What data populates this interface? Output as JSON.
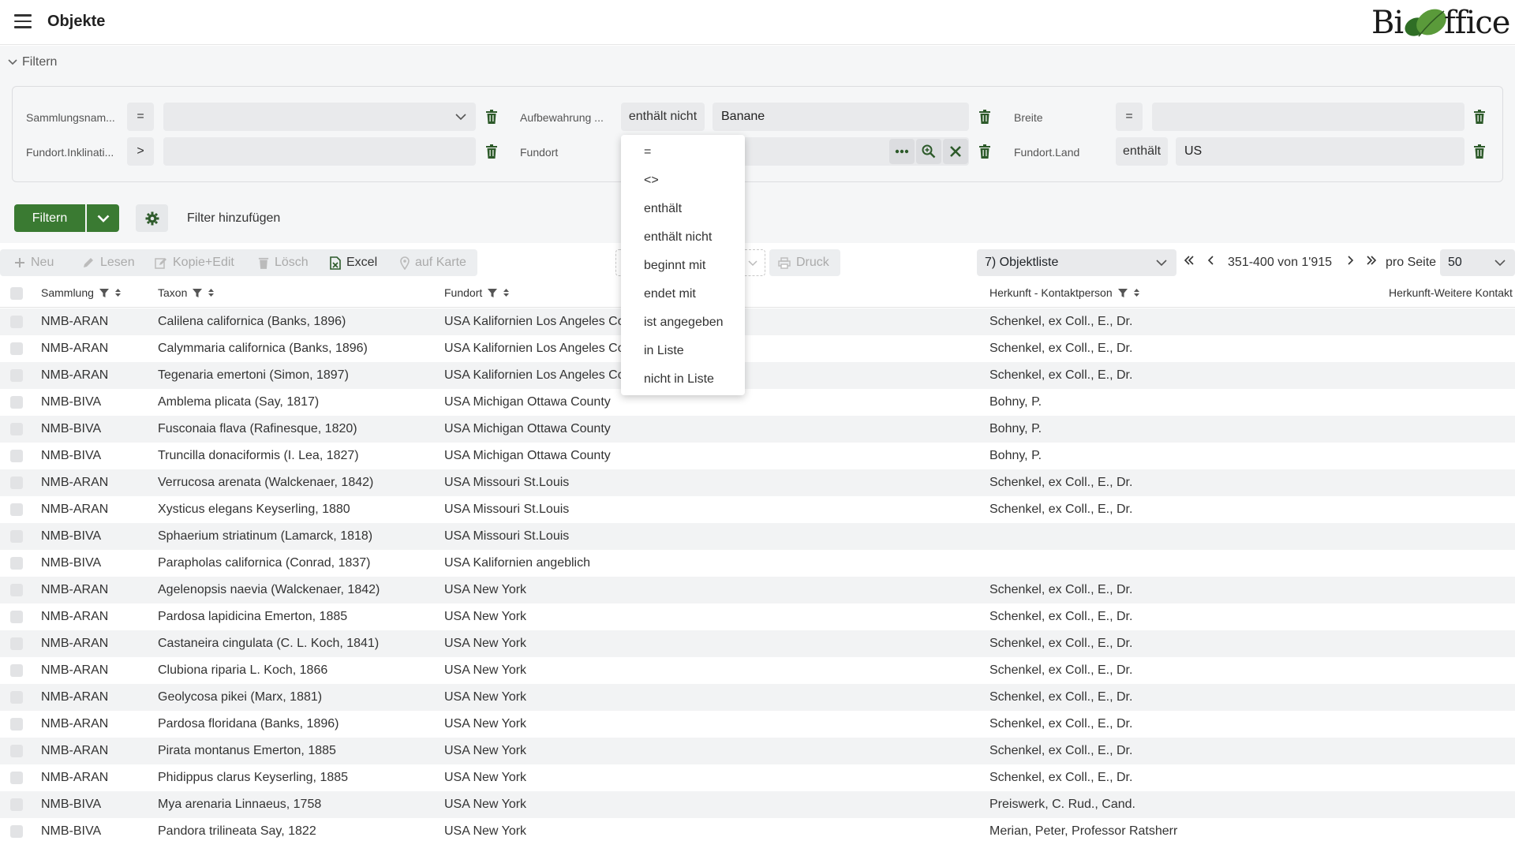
{
  "header": {
    "title": "Objekte",
    "logo_text_left": "Bi",
    "logo_text_right": "ffice"
  },
  "filter_panel": {
    "toggle_label": "Filtern",
    "rows": [
      [
        {
          "label": "Sammlungsnam...",
          "op": "=",
          "value": ""
        },
        {
          "label": "Aufbewahrung ...",
          "op": "enthält nicht",
          "value": "Banane"
        },
        {
          "label": "Breite",
          "op": "=",
          "value": ""
        }
      ],
      [
        {
          "label": "Fundort.Inklinati...",
          "op": ">",
          "value": ""
        },
        {
          "label": "Fundort",
          "op": "",
          "value": ""
        },
        {
          "label": "Fundort.Land",
          "op": "enthält",
          "value": "US"
        }
      ]
    ],
    "filter_button": "Filtern",
    "add_filter": "Filter hinzufügen"
  },
  "operator_dropdown": {
    "options": [
      "=",
      "<>",
      "enthält",
      "enthält nicht",
      "beginnt mit",
      "endet mit",
      "ist angegeben",
      "in Liste",
      "nicht in Liste"
    ]
  },
  "toolbar": {
    "new": "Neu",
    "read": "Lesen",
    "copy_edit": "Kopie+Edit",
    "delete": "Lösch",
    "excel": "Excel",
    "map": "auf Karte",
    "print": "Druck",
    "list_select": "7) Objektliste",
    "page_info": "351-400 von 1'915",
    "per_page_label": "pro Seite",
    "per_page_value": "50"
  },
  "table": {
    "columns": [
      "Sammlung",
      "Taxon",
      "Fundort",
      "Herkunft - Kontaktperson",
      "Herkunft-Weitere Kontakt"
    ],
    "rows": [
      [
        "NMB-ARAN",
        "Calilena californica (Banks, 1896)",
        "USA Kalifornien Los Angeles Co",
        "Schenkel, ex Coll., E., Dr."
      ],
      [
        "NMB-ARAN",
        "Calymmaria californica (Banks, 1896)",
        "USA Kalifornien Los Angeles Co",
        "Schenkel, ex Coll., E., Dr."
      ],
      [
        "NMB-ARAN",
        "Tegenaria emertoni (Simon, 1897)",
        "USA Kalifornien Los Angeles Co",
        "Schenkel, ex Coll., E., Dr."
      ],
      [
        "NMB-BIVA",
        "Amblema plicata (Say, 1817)",
        "USA Michigan Ottawa County",
        "Bohny, P."
      ],
      [
        "NMB-BIVA",
        "Fusconaia flava (Rafinesque, 1820)",
        "USA Michigan Ottawa County",
        "Bohny, P."
      ],
      [
        "NMB-BIVA",
        "Truncilla donaciformis (I. Lea, 1827)",
        "USA Michigan Ottawa County",
        "Bohny, P."
      ],
      [
        "NMB-ARAN",
        "Verrucosa arenata (Walckenaer, 1842)",
        "USA Missouri St.Louis",
        "Schenkel, ex Coll., E., Dr."
      ],
      [
        "NMB-ARAN",
        "Xysticus elegans Keyserling, 1880",
        "USA Missouri St.Louis",
        "Schenkel, ex Coll., E., Dr."
      ],
      [
        "NMB-BIVA",
        "Sphaerium striatinum (Lamarck, 1818)",
        "USA Missouri St.Louis",
        ""
      ],
      [
        "NMB-BIVA",
        "Parapholas californica (Conrad, 1837)",
        "USA Kalifornien angeblich",
        ""
      ],
      [
        "NMB-ARAN",
        "Agelenopsis naevia (Walckenaer, 1842)",
        "USA New York",
        "Schenkel, ex Coll., E., Dr."
      ],
      [
        "NMB-ARAN",
        "Pardosa lapidicina Emerton, 1885",
        "USA New York",
        "Schenkel, ex Coll., E., Dr."
      ],
      [
        "NMB-ARAN",
        "Castaneira cingulata (C. L. Koch, 1841)",
        "USA New York",
        "Schenkel, ex Coll., E., Dr."
      ],
      [
        "NMB-ARAN",
        "Clubiona riparia L. Koch, 1866",
        "USA New York",
        "Schenkel, ex Coll., E., Dr."
      ],
      [
        "NMB-ARAN",
        "Geolycosa pikei (Marx, 1881)",
        "USA New York",
        "Schenkel, ex Coll., E., Dr."
      ],
      [
        "NMB-ARAN",
        "Pardosa floridana (Banks, 1896)",
        "USA New York",
        "Schenkel, ex Coll., E., Dr."
      ],
      [
        "NMB-ARAN",
        "Pirata montanus Emerton, 1885",
        "USA New York",
        "Schenkel, ex Coll., E., Dr."
      ],
      [
        "NMB-ARAN",
        "Phidippus clarus Keyserling, 1885",
        "USA New York",
        "Schenkel, ex Coll., E., Dr."
      ],
      [
        "NMB-BIVA",
        "Mya arenaria Linnaeus, 1758",
        "USA New York",
        "Preiswerk, C. Rud., Cand."
      ],
      [
        "NMB-BIVA",
        "Pandora trilineata Say, 1822",
        "USA New York",
        "Merian, Peter, Professor Ratsherr"
      ]
    ]
  },
  "colors": {
    "primary_green": "#3a7a32",
    "row_stripe": "#f2f3f4",
    "panel_bg": "#f5f6f7"
  }
}
